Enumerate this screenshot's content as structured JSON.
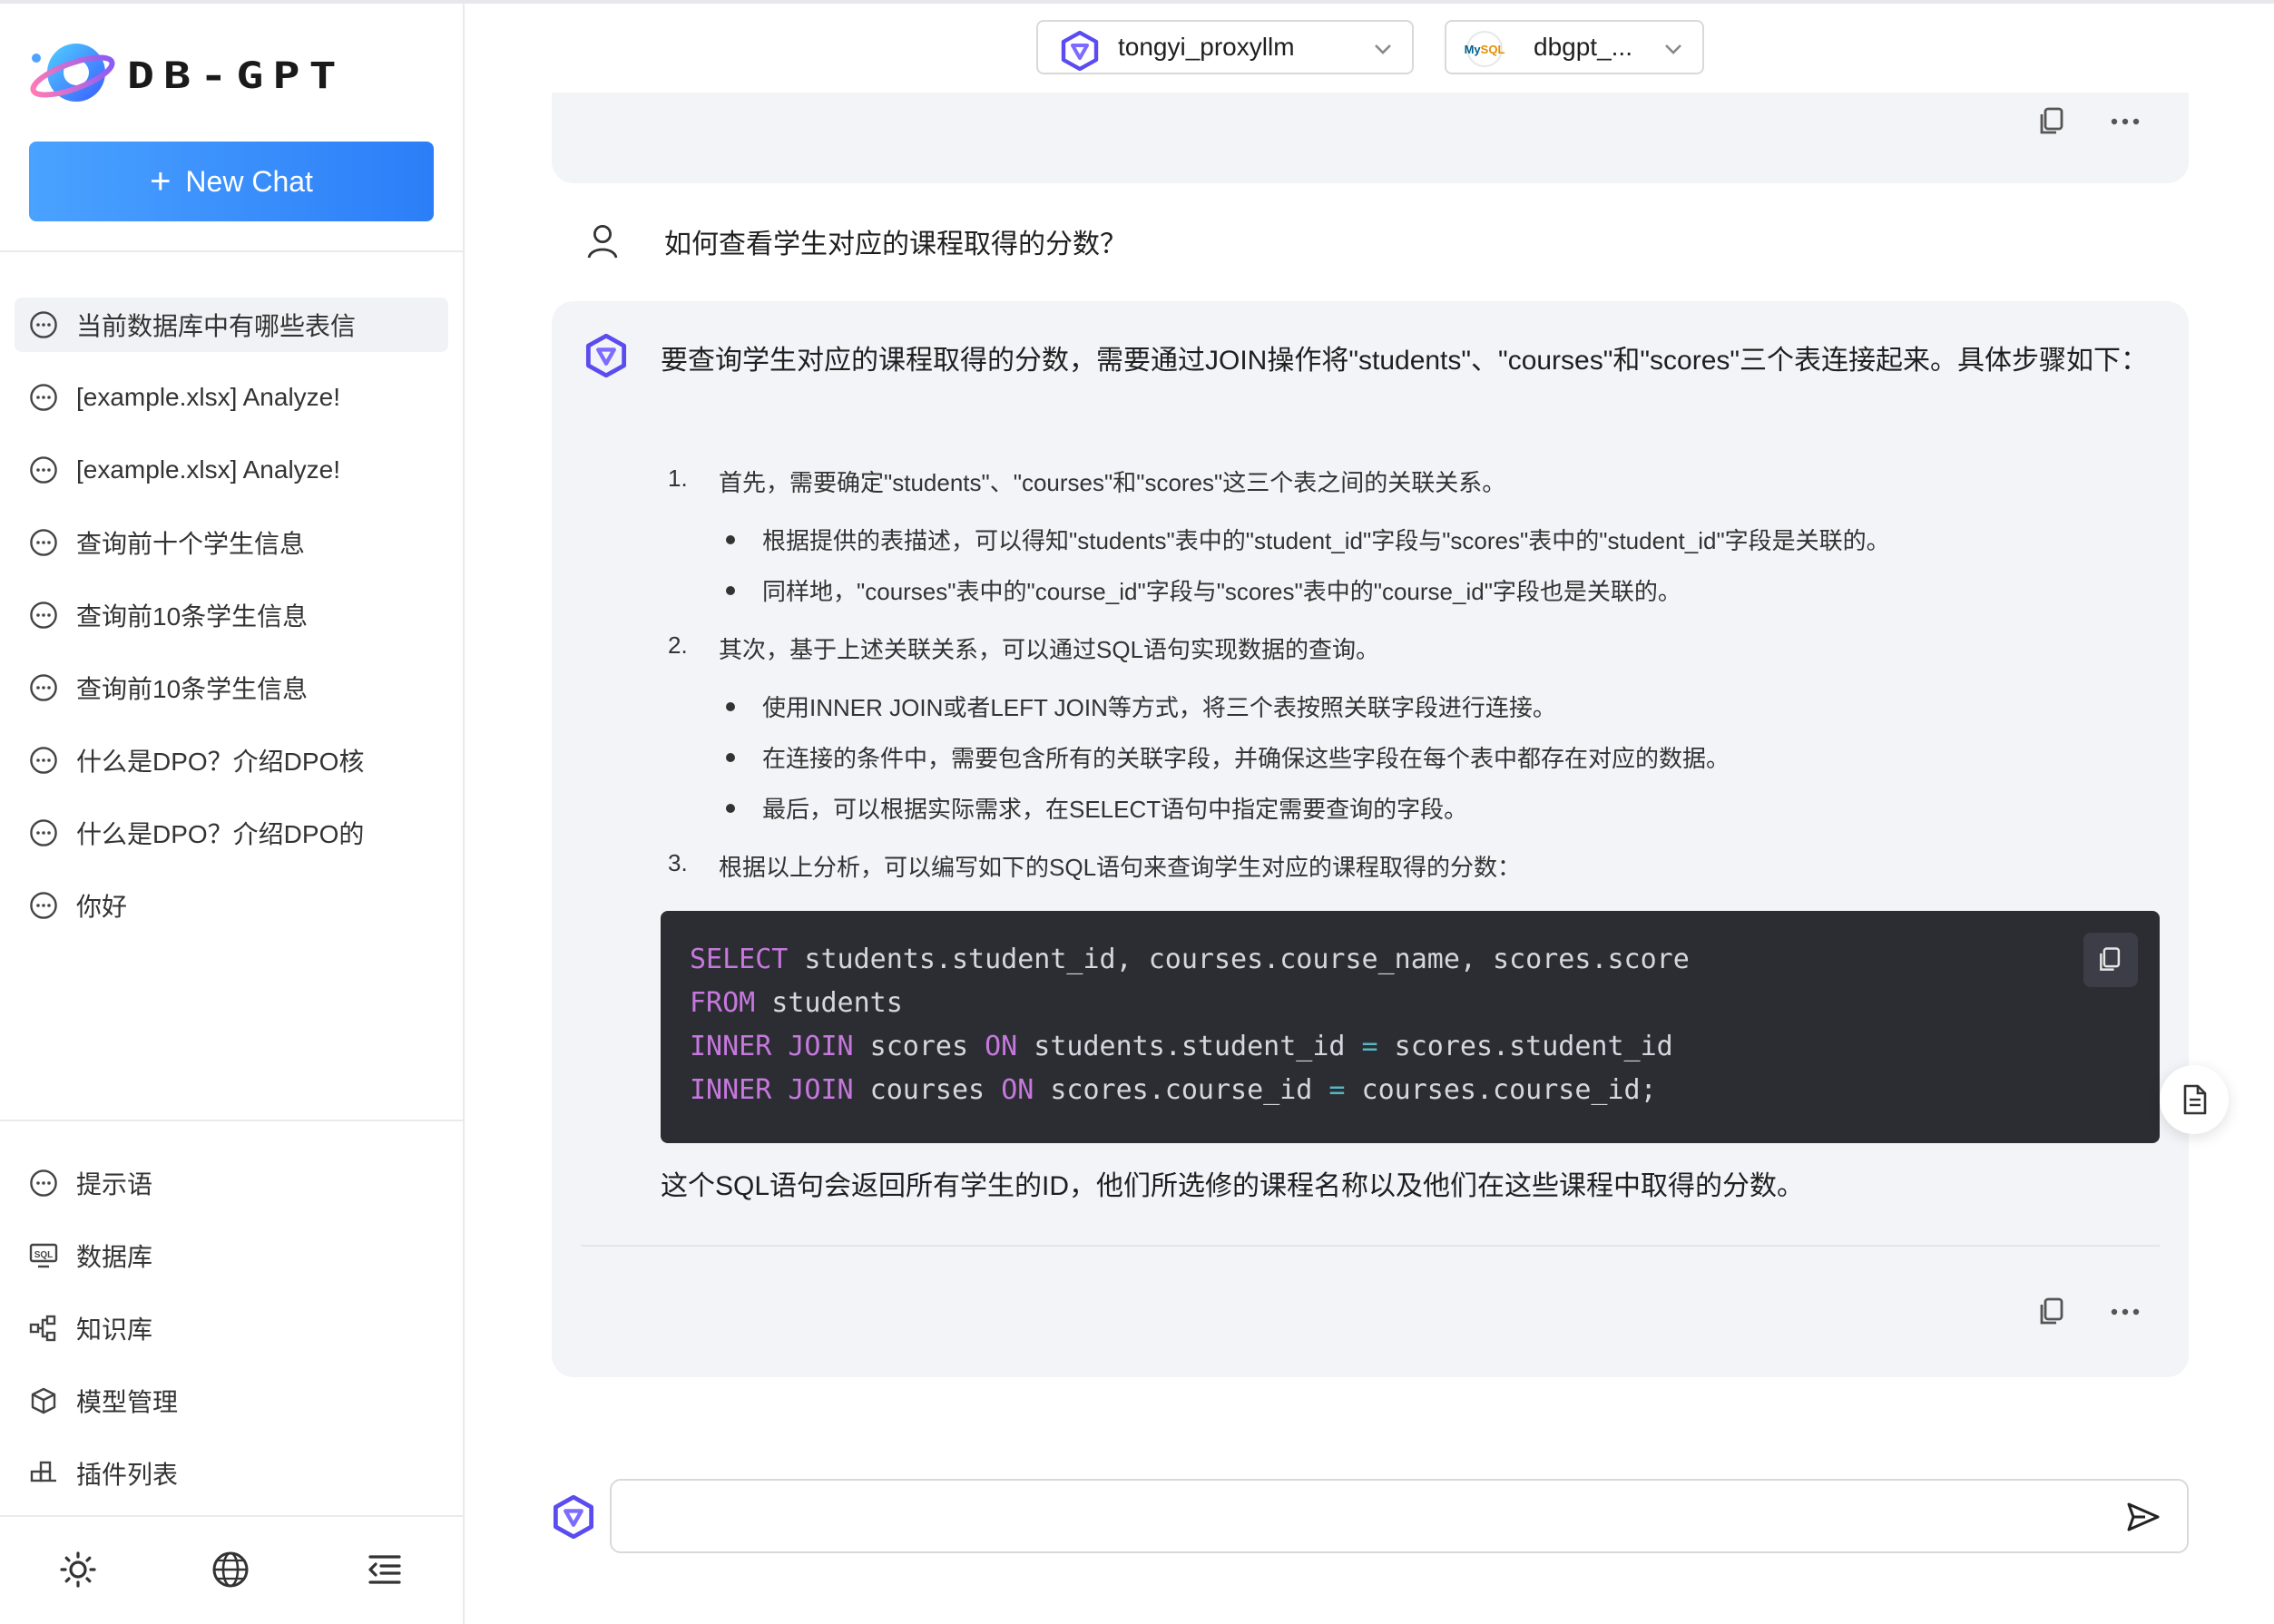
{
  "app": {
    "brand": "DB-GPT"
  },
  "sidebar": {
    "new_chat_label": "New Chat",
    "conversations": [
      {
        "label": "当前数据库中有哪些表信"
      },
      {
        "label": "[example.xlsx] Analyze!"
      },
      {
        "label": "[example.xlsx] Analyze!"
      },
      {
        "label": "查询前十个学生信息"
      },
      {
        "label": "查询前10条学生信息"
      },
      {
        "label": "查询前10条学生信息"
      },
      {
        "label": "什么是DPO？介绍DPO核"
      },
      {
        "label": "什么是DPO？介绍DPO的"
      },
      {
        "label": "你好"
      }
    ],
    "menu": [
      {
        "label": "提示语",
        "icon": "message-icon"
      },
      {
        "label": "数据库",
        "icon": "sql-icon"
      },
      {
        "label": "知识库",
        "icon": "knowledge-icon"
      },
      {
        "label": "模型管理",
        "icon": "cube-icon"
      },
      {
        "label": "插件列表",
        "icon": "plugin-icon"
      }
    ],
    "bottom_icons": [
      "sun-icon",
      "globe-icon",
      "collapse-menu-icon"
    ]
  },
  "header": {
    "model_select": {
      "value": "tongyi_proxyllm"
    },
    "db_select": {
      "value": "dbgpt_..."
    }
  },
  "chat": {
    "user_question": "如何查看学生对应的课程取得的分数？",
    "answer": {
      "intro": "要查询学生对应的课程取得的分数，需要通过JOIN操作将\"students\"、\"courses\"和\"scores\"三个表连接起来。具体步骤如下：",
      "steps": [
        {
          "num": "1.",
          "text": "首先，需要确定\"students\"、\"courses\"和\"scores\"这三个表之间的关联关系。",
          "bullets": [
            "根据提供的表描述，可以得知\"students\"表中的\"student_id\"字段与\"scores\"表中的\"student_id\"字段是关联的。",
            "同样地，\"courses\"表中的\"course_id\"字段与\"scores\"表中的\"course_id\"字段也是关联的。"
          ]
        },
        {
          "num": "2.",
          "text": "其次，基于上述关联关系，可以通过SQL语句实现数据的查询。",
          "bullets": [
            "使用INNER JOIN或者LEFT JOIN等方式，将三个表按照关联字段进行连接。",
            "在连接的条件中，需要包含所有的关联字段，并确保这些字段在每个表中都存在对应的数据。",
            "最后，可以根据实际需求，在SELECT语句中指定需要查询的字段。"
          ]
        },
        {
          "num": "3.",
          "text": "根据以上分析，可以编写如下的SQL语句来查询学生对应的课程取得的分数："
        }
      ],
      "code": {
        "kw_select": "SELECT",
        "l1_rest": " students.student_id, courses.course_name, scores.score",
        "kw_from": "FROM",
        "l2_rest": " students",
        "kw_inner1": "INNER JOIN",
        "l3_a": " scores ",
        "kw_on1": "ON",
        "l3_b": " students.student_id ",
        "eq": "=",
        "l3_c": " scores.student_id",
        "kw_inner2": "INNER JOIN",
        "l4_a": " courses ",
        "kw_on2": "ON",
        "l4_b": " scores.course_id ",
        "l4_c": " courses.course_id;"
      },
      "conclusion": "这个SQL语句会返回所有学生的ID，他们所选修的课程名称以及他们在这些课程中取得的分数。"
    }
  },
  "input": {
    "placeholder": "",
    "value": ""
  },
  "colors": {
    "accent": "#2c7ef8",
    "keyword": "#c678dd",
    "operator": "#56b6c2",
    "code_bg": "#2b2d33",
    "card_bg": "#f3f4f7"
  }
}
